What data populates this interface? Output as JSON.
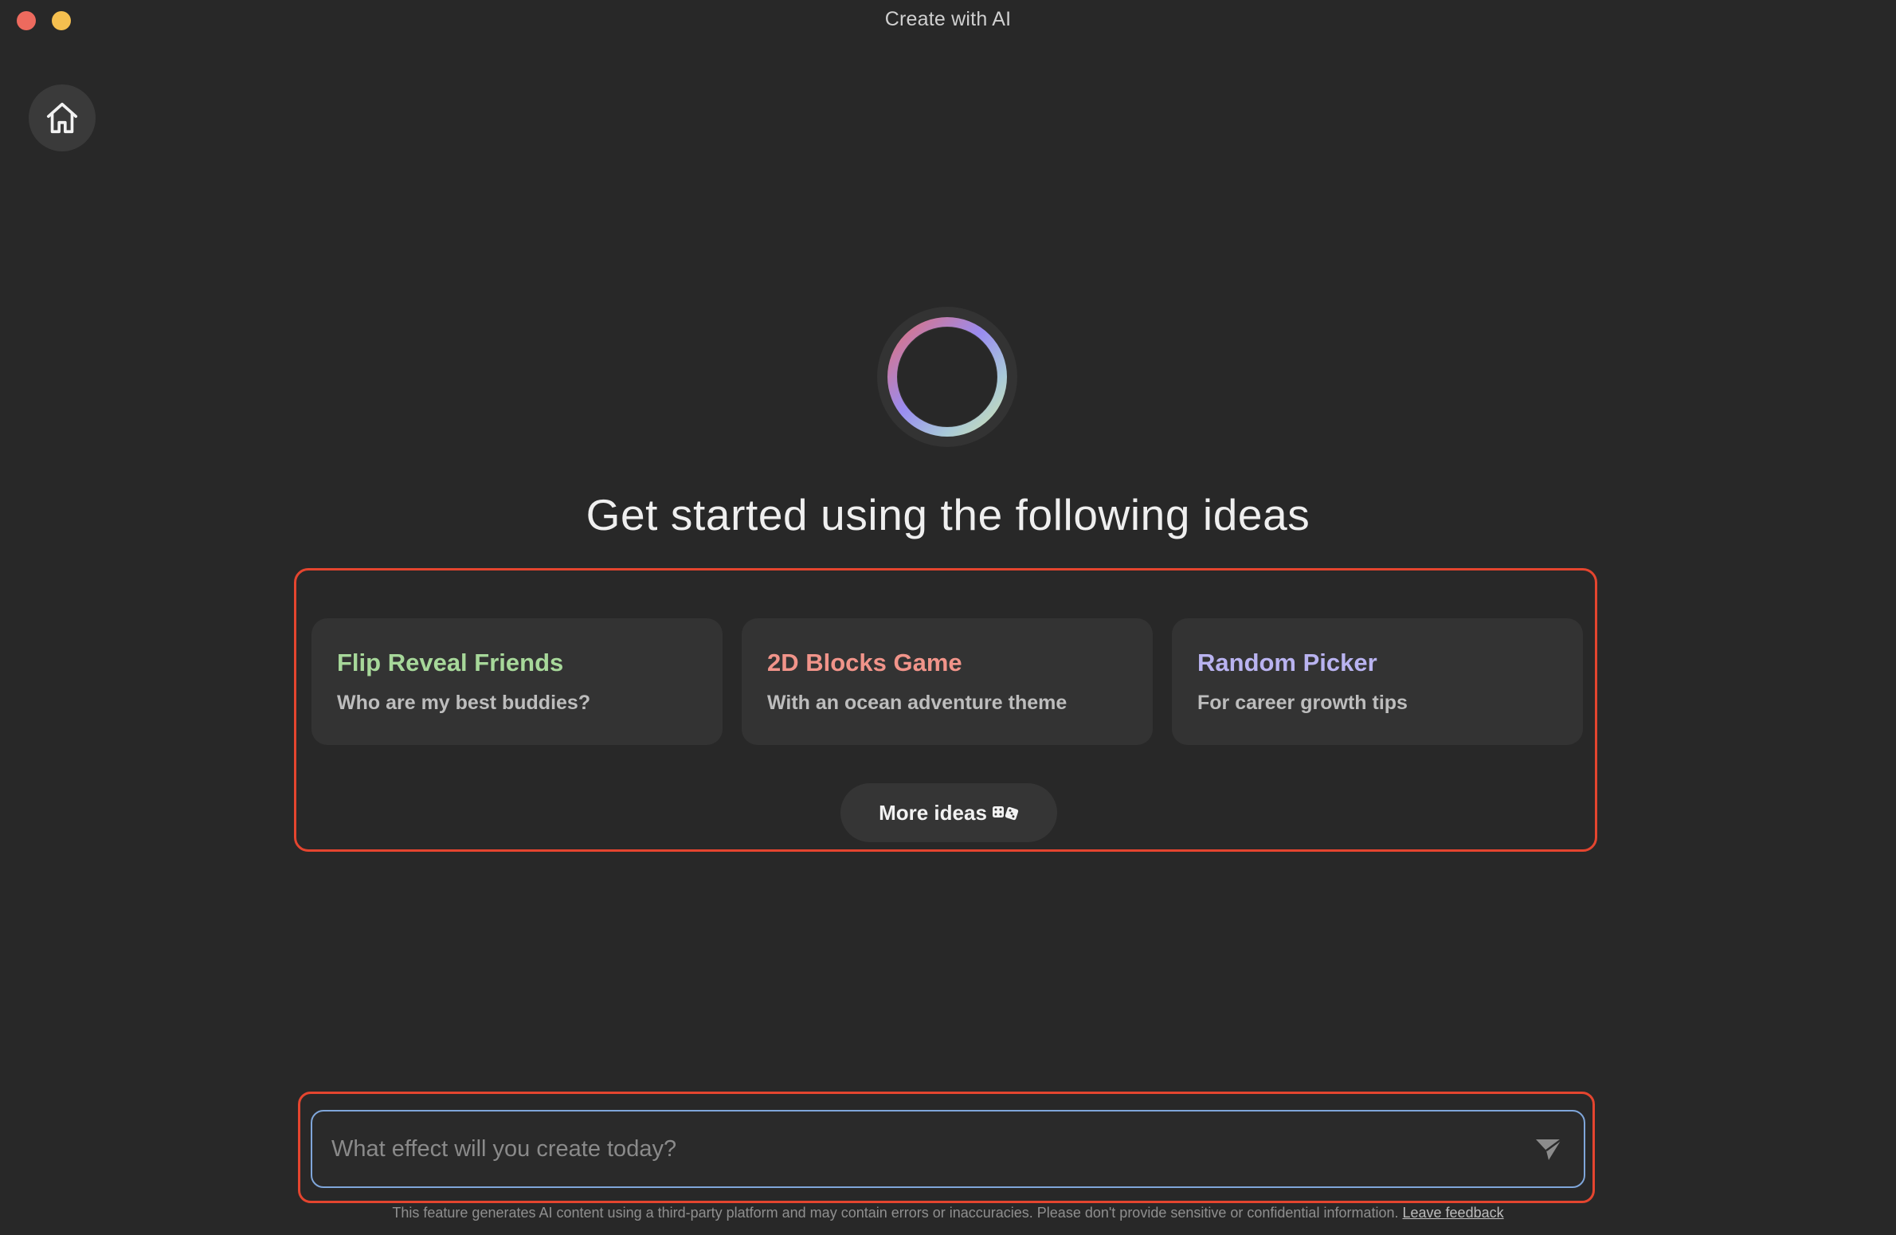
{
  "window": {
    "title": "Create with AI"
  },
  "headline": "Get started using the following ideas",
  "ideas": [
    {
      "title": "Flip Reveal Friends",
      "subtitle": "Who are my best buddies?",
      "color": "#a7d89a"
    },
    {
      "title": "2D Blocks Game",
      "subtitle": "With an ocean adventure theme",
      "color": "#f1948a"
    },
    {
      "title": "Random Picker",
      "subtitle": "For career growth tips",
      "color": "#b9b3f0"
    }
  ],
  "more_ideas": {
    "label": "More ideas",
    "icon": "dice-icon"
  },
  "prompt": {
    "placeholder": "What effect will you create today?",
    "value": "",
    "send_icon": "send-icon"
  },
  "disclaimer": {
    "text": "This feature generates AI content using a third-party platform and may contain errors or inaccuracies. Please don't provide sensitive or confidential information.",
    "link_label": "Leave feedback"
  },
  "colors": {
    "background": "#282828",
    "highlight_border": "#e4452f",
    "input_border": "#7fa6da"
  }
}
